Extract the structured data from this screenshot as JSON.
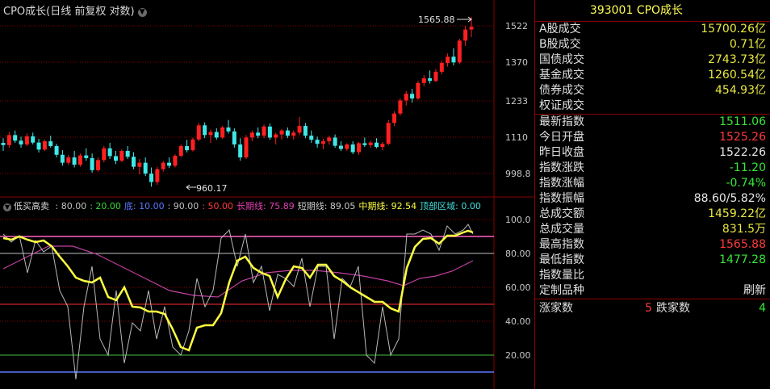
{
  "chart": {
    "title": "CPO成长(日线 前复权 对数)",
    "price_ticks": [
      "1522",
      "1370",
      "1233",
      "1110",
      "998.8"
    ],
    "high_label": "1565.88",
    "low_label": "960.17",
    "indicator_ticks": [
      "100.0",
      "80.00",
      "60.00",
      "40.00",
      "20.00"
    ],
    "indicator": {
      "name": "低买高卖",
      "params": [
        {
          "text": ": 80.00",
          "color": "#c0c0c0"
        },
        {
          "text": ": 20.00",
          "color": "#35d835"
        },
        {
          "text": "底: 10.00",
          "color": "#5a78ff"
        },
        {
          "text": ": 90.00",
          "color": "#c0c0c0"
        },
        {
          "text": ": 50.00",
          "color": "#ff3b3b"
        },
        {
          "text": "长期线: 75.89",
          "color": "#e040b0"
        },
        {
          "text": "短期线: 89.05",
          "color": "#c8c8c8"
        },
        {
          "text": "中期线: 92.54",
          "color": "#ffff40"
        },
        {
          "text": "顶部区域: 0.00",
          "color": "#40e0e0"
        }
      ]
    }
  },
  "chart_data": {
    "type": "candlestick",
    "y_scale": "log",
    "ylim": [
      940,
      1600
    ],
    "candles": [
      [
        1085,
        1100,
        1060,
        1078
      ],
      [
        1078,
        1120,
        1070,
        1110
      ],
      [
        1110,
        1125,
        1085,
        1092
      ],
      [
        1092,
        1105,
        1070,
        1080
      ],
      [
        1080,
        1115,
        1075,
        1106
      ],
      [
        1106,
        1118,
        1080,
        1086
      ],
      [
        1086,
        1098,
        1055,
        1064
      ],
      [
        1064,
        1095,
        1060,
        1090
      ],
      [
        1090,
        1108,
        1070,
        1075
      ],
      [
        1075,
        1082,
        1040,
        1048
      ],
      [
        1048,
        1062,
        1015,
        1024
      ],
      [
        1024,
        1048,
        1018,
        1040
      ],
      [
        1040,
        1060,
        1010,
        1018
      ],
      [
        1018,
        1052,
        1012,
        1046
      ],
      [
        1046,
        1068,
        1030,
        1038
      ],
      [
        1038,
        1052,
        995,
        1002
      ],
      [
        1002,
        1040,
        998,
        1032
      ],
      [
        1032,
        1075,
        1025,
        1068
      ],
      [
        1068,
        1085,
        1035,
        1044
      ],
      [
        1044,
        1060,
        1020,
        1030
      ],
      [
        1030,
        1066,
        1026,
        1060
      ],
      [
        1060,
        1075,
        1035,
        1042
      ],
      [
        1042,
        1056,
        1005,
        1012
      ],
      [
        1012,
        1035,
        990,
        1024
      ],
      [
        1024,
        1040,
        985,
        992
      ],
      [
        992,
        1010,
        955,
        968
      ],
      [
        968,
        1012,
        960,
        1005
      ],
      [
        1005,
        1030,
        998,
        1024
      ],
      [
        1024,
        1040,
        1008,
        1015
      ],
      [
        1015,
        1050,
        1010,
        1045
      ],
      [
        1045,
        1080,
        1040,
        1075
      ],
      [
        1075,
        1095,
        1055,
        1062
      ],
      [
        1062,
        1102,
        1058,
        1096
      ],
      [
        1096,
        1150,
        1090,
        1142
      ],
      [
        1142,
        1152,
        1100,
        1110
      ],
      [
        1110,
        1128,
        1085,
        1120
      ],
      [
        1120,
        1132,
        1095,
        1102
      ],
      [
        1102,
        1140,
        1098,
        1135
      ],
      [
        1135,
        1160,
        1115,
        1122
      ],
      [
        1122,
        1132,
        1070,
        1080
      ],
      [
        1080,
        1100,
        1030,
        1040
      ],
      [
        1040,
        1110,
        1035,
        1102
      ],
      [
        1102,
        1125,
        1090,
        1118
      ],
      [
        1118,
        1135,
        1100,
        1108
      ],
      [
        1108,
        1145,
        1100,
        1138
      ],
      [
        1138,
        1148,
        1095,
        1102
      ],
      [
        1102,
        1118,
        1080,
        1112
      ],
      [
        1112,
        1130,
        1095,
        1125
      ],
      [
        1125,
        1135,
        1100,
        1108
      ],
      [
        1108,
        1125,
        1095,
        1118
      ],
      [
        1118,
        1170,
        1110,
        1140
      ],
      [
        1140,
        1150,
        1100,
        1108
      ],
      [
        1108,
        1125,
        1085,
        1095
      ],
      [
        1095,
        1105,
        1070,
        1082
      ],
      [
        1082,
        1098,
        1065,
        1090
      ],
      [
        1090,
        1108,
        1080,
        1102
      ],
      [
        1102,
        1112,
        1070,
        1076
      ],
      [
        1076,
        1090,
        1060,
        1066
      ],
      [
        1066,
        1084,
        1060,
        1080
      ],
      [
        1080,
        1090,
        1050,
        1056
      ],
      [
        1056,
        1088,
        1048,
        1084
      ],
      [
        1084,
        1102,
        1072,
        1078
      ],
      [
        1078,
        1092,
        1070,
        1086
      ],
      [
        1086,
        1100,
        1068,
        1072
      ],
      [
        1072,
        1088,
        1062,
        1082
      ],
      [
        1082,
        1160,
        1078,
        1150
      ],
      [
        1150,
        1190,
        1140,
        1182
      ],
      [
        1182,
        1235,
        1175,
        1228
      ],
      [
        1228,
        1262,
        1210,
        1252
      ],
      [
        1252,
        1270,
        1220,
        1235
      ],
      [
        1235,
        1300,
        1230,
        1292
      ],
      [
        1292,
        1322,
        1280,
        1310
      ],
      [
        1310,
        1340,
        1290,
        1300
      ],
      [
        1300,
        1345,
        1295,
        1335
      ],
      [
        1335,
        1378,
        1325,
        1370
      ],
      [
        1370,
        1408,
        1355,
        1395
      ],
      [
        1395,
        1430,
        1360,
        1372
      ],
      [
        1372,
        1470,
        1365,
        1462
      ],
      [
        1462,
        1525,
        1440,
        1510
      ],
      [
        1510,
        1566,
        1477,
        1522
      ]
    ]
  },
  "panel": {
    "title": "393001 CPO成长",
    "trade": [
      {
        "label": "A股成交",
        "value": "15700.26亿",
        "color": "yellow"
      },
      {
        "label": "B股成交",
        "value": "0.71亿",
        "color": "yellow"
      },
      {
        "label": "国债成交",
        "value": "2743.73亿",
        "color": "yellow"
      },
      {
        "label": "基金成交",
        "value": "1260.54亿",
        "color": "yellow"
      },
      {
        "label": "债券成交",
        "value": "454.93亿",
        "color": "yellow"
      },
      {
        "label": "权证成交",
        "value": "",
        "color": "yellow"
      }
    ],
    "stats": [
      {
        "label": "最新指数",
        "value": "1511.06",
        "color": "green"
      },
      {
        "label": "今日开盘",
        "value": "1525.26",
        "color": "red"
      },
      {
        "label": "昨日收盘",
        "value": "1522.26",
        "color": "white"
      },
      {
        "label": "指数涨跌",
        "value": "-11.20",
        "color": "green"
      },
      {
        "label": "指数涨幅",
        "value": "-0.74%",
        "color": "green"
      },
      {
        "label": "指数振幅",
        "value": "88.60/5.82%",
        "color": "white"
      },
      {
        "label": "总成交额",
        "value": "1459.22亿",
        "color": "yellow"
      },
      {
        "label": "总成交量",
        "value": "831.5万",
        "color": "yellow"
      },
      {
        "label": "最高指数",
        "value": "1565.88",
        "color": "red"
      },
      {
        "label": "最低指数",
        "value": "1477.28",
        "color": "green"
      },
      {
        "label": "指数量比",
        "value": "",
        "color": "white"
      },
      {
        "label": "定制品种",
        "value": "刷新",
        "color": "white"
      }
    ],
    "bottom": {
      "up_label": "涨家数",
      "up_value": "5",
      "down_label": "跌家数",
      "down_value": "4"
    }
  }
}
